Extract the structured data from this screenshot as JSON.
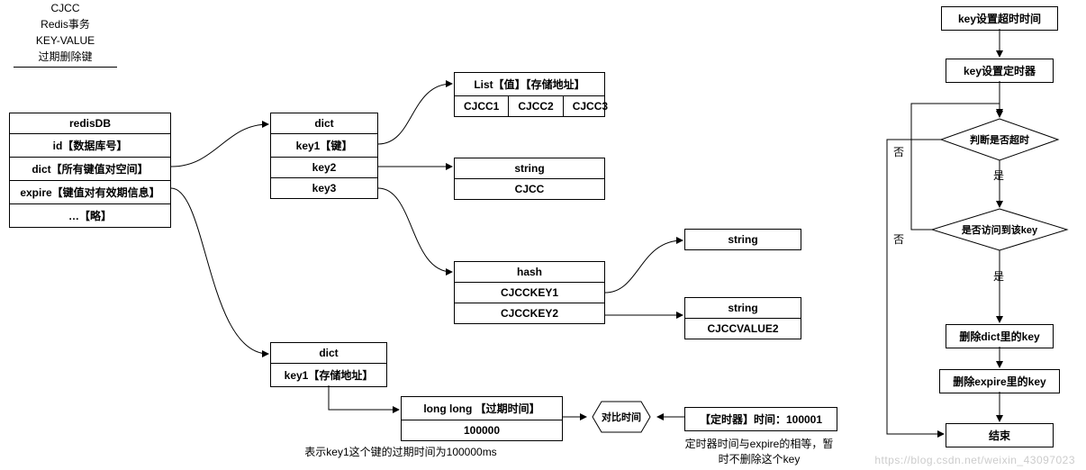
{
  "title": {
    "l1": "CJCC",
    "l2": "Redis事务",
    "l3": "KEY-VALUE",
    "l4": "过期删除键"
  },
  "redisDB": {
    "header": "redisDB",
    "r1": "id【数据库号】",
    "r2": "dict【所有键值对空间】",
    "r3": "expire【键值对有效期信息】",
    "r4": "…【略】"
  },
  "dict1": {
    "header": "dict",
    "r1": "key1【键】",
    "r2": "key2",
    "r3": "key3"
  },
  "list": {
    "header": "List【值】【存储地址】",
    "c1": "CJCC1",
    "c2": "CJCC2",
    "c3": "CJCC3"
  },
  "string1": {
    "header": "string",
    "val": "CJCC"
  },
  "hash": {
    "header": "hash",
    "r1": "CJCCKEY1",
    "r2": "CJCCKEY2"
  },
  "subhash1": "string",
  "subhash2": {
    "header": "string",
    "val": "CJCCVALUE2"
  },
  "dict2": {
    "header": "dict",
    "r1": "key1【存储地址】"
  },
  "longlong": {
    "header": "long long 【过期时间】",
    "val": "100000"
  },
  "compare": "对比时间",
  "timer": "【定时器】时间：100001",
  "note1": "表示key1这个键的过期时间为100000ms",
  "note2a": "定时器时间与expire的相等，暂",
  "note2b": "时不删除这个key",
  "flow": {
    "s1": "key设置超时时间",
    "s2": "key设置定时器",
    "d1": "判断是否超时",
    "d2": "是否访问到该key",
    "s3": "删除dict里的key",
    "s4": "删除expire里的key",
    "s5": "结束",
    "yes1": "是",
    "no1": "否",
    "yes2": "是",
    "no2": "否"
  },
  "watermark": "https://blog.csdn.net/weixin_43097023"
}
